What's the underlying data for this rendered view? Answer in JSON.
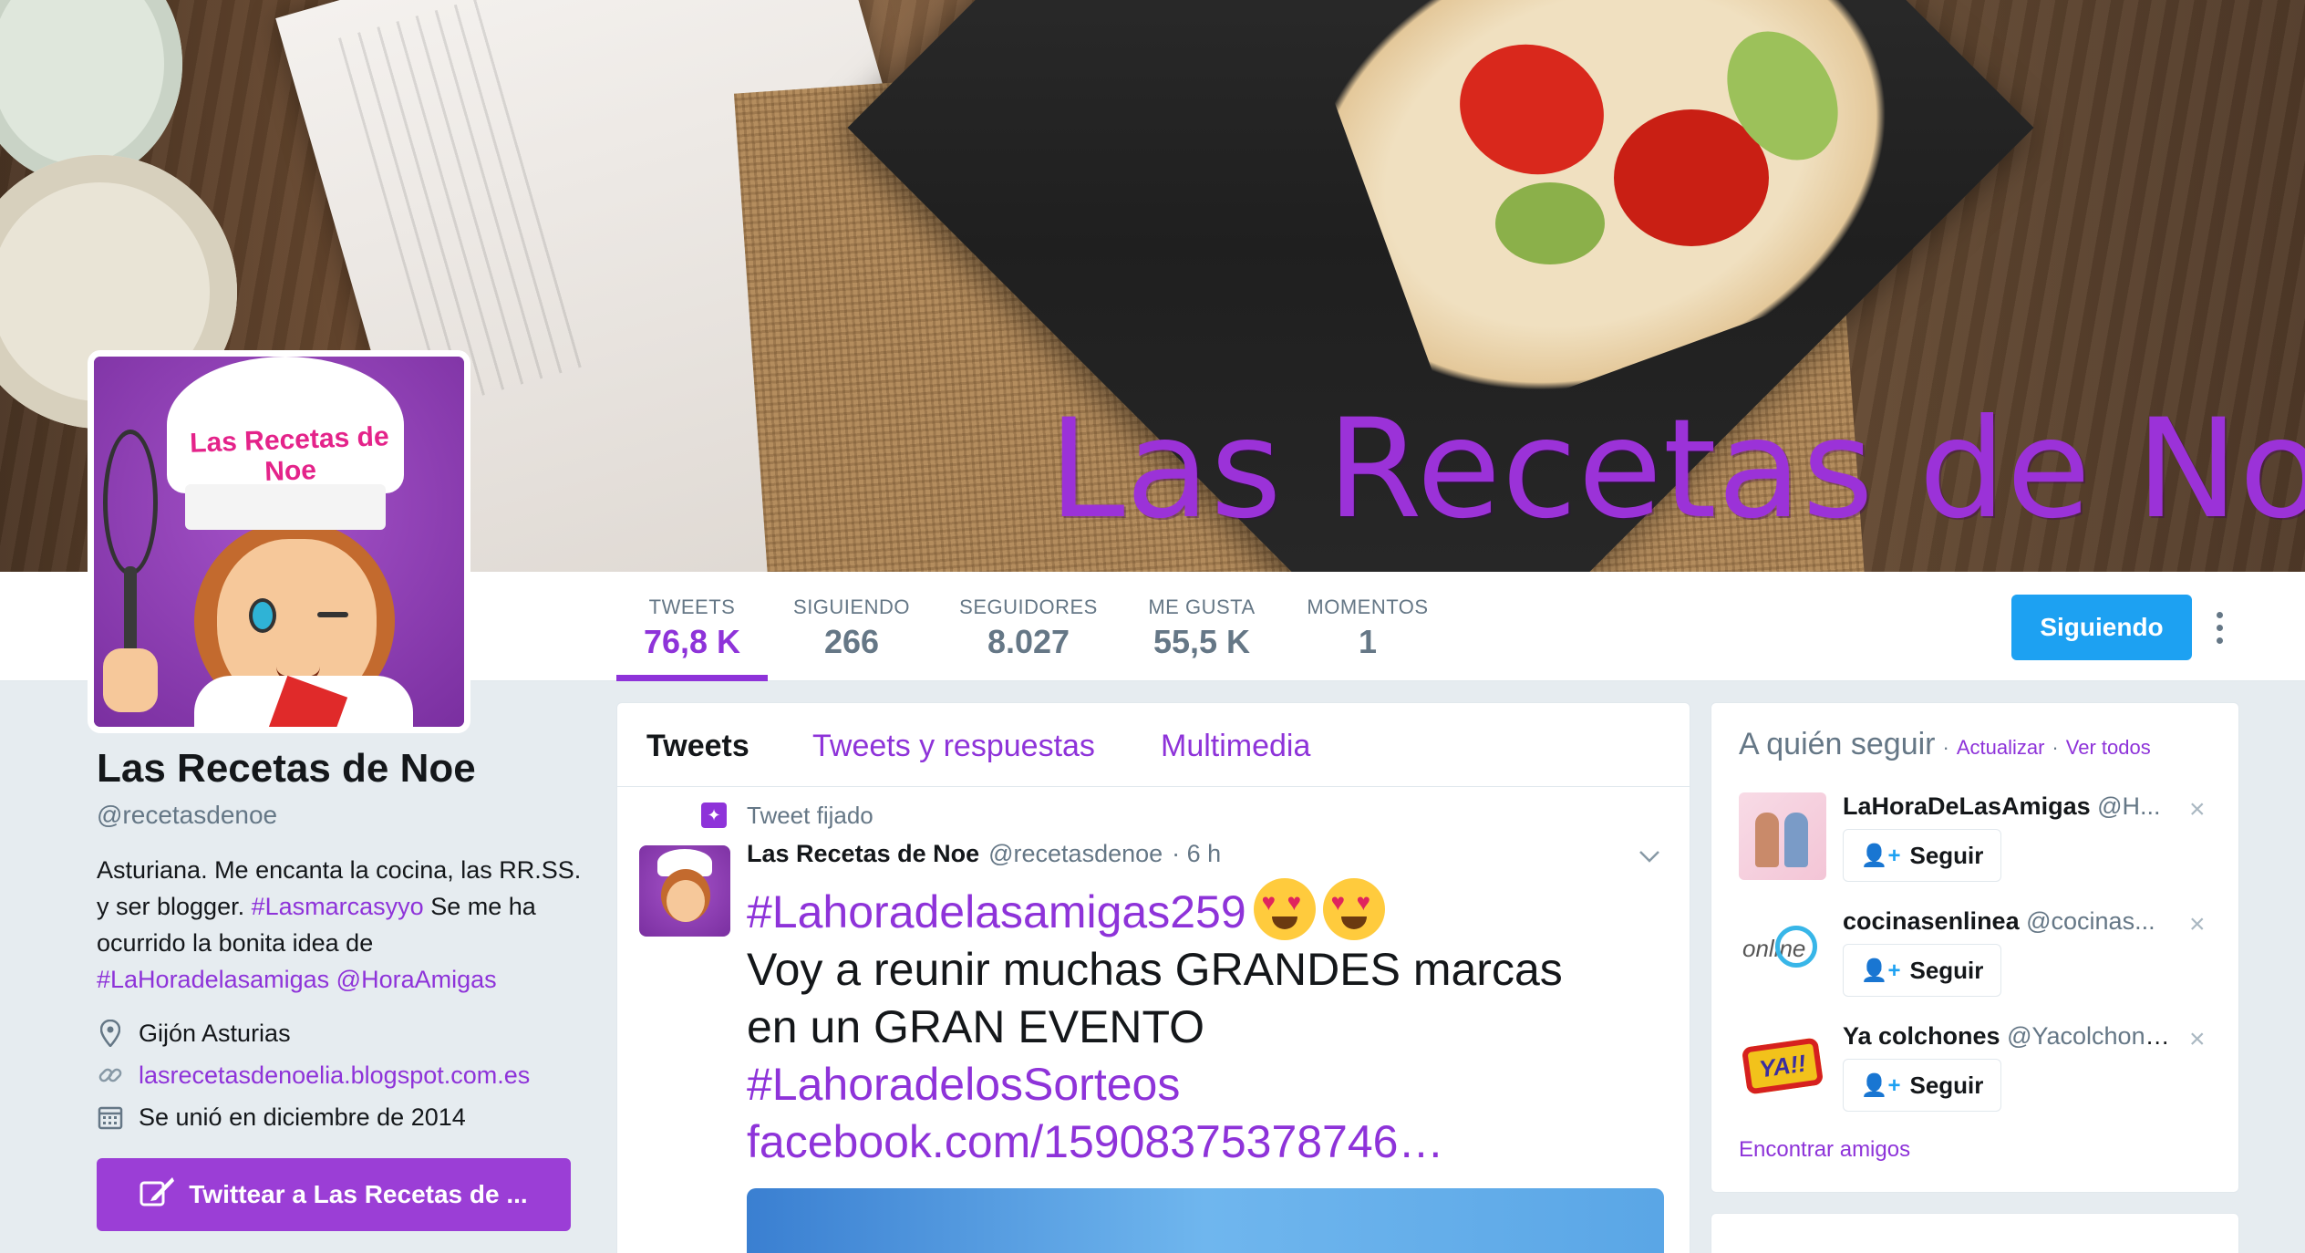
{
  "banner": {
    "title": "Las Recetas de Noe"
  },
  "avatar": {
    "text": "Las Recetas de Noe"
  },
  "nav": {
    "stats": [
      {
        "label": "TWEETS",
        "value": "76,8 K",
        "active": true
      },
      {
        "label": "SIGUIENDO",
        "value": "266"
      },
      {
        "label": "SEGUIDORES",
        "value": "8.027"
      },
      {
        "label": "ME GUSTA",
        "value": "55,5 K"
      },
      {
        "label": "MOMENTOS",
        "value": "1"
      }
    ],
    "follow_button": "Siguiendo"
  },
  "profile": {
    "name": "Las Recetas de Noe",
    "handle": "@recetasdenoe",
    "bio": {
      "part1": "Asturiana. Me encanta la cocina, las RR.SS. y ser blogger. ",
      "tag1": "#Lasmarcasyyo",
      "part2": " Se me ha ocurrido la bonita idea de ",
      "tag2": "#LaHoradelasamigas",
      "part3": " ",
      "tag3": "@HoraAmigas"
    },
    "location": "Gijón Asturias",
    "website": "lasrecetasdenoelia.blogspot.com.es",
    "joined": "Se unió en diciembre de 2014",
    "tweet_to_button": "Twittear a Las Recetas de ..."
  },
  "timeline": {
    "tabs": [
      "Tweets",
      "Tweets y respuestas",
      "Multimedia"
    ],
    "pinned_label": "Tweet fijado",
    "tweet": {
      "author_name": "Las Recetas de Noe",
      "author_handle": "@recetasdenoe",
      "time": "· 6 h",
      "hashtag1": "#Lahoradelasamigas259",
      "line1": "Voy a reunir muchas GRANDES marcas",
      "line2": "en un GRAN EVENTO",
      "hashtag2": "#LahoradelosSorteos",
      "link": "facebook.com/15908375378746…"
    }
  },
  "who_to_follow": {
    "title": "A quién seguir",
    "refresh": "Actualizar",
    "view_all": "Ver todos",
    "separator": "·",
    "follow_label": "Seguir",
    "find_friends": "Encontrar amigos",
    "items": [
      {
        "name": "LaHoraDeLasAmigas",
        "handle": "@H..."
      },
      {
        "name": "cocinasenlinea",
        "handle": "@cocinas..."
      },
      {
        "name": "Ya colchones",
        "handle": "@Yacolchones"
      }
    ],
    "thumb2_text": "online",
    "thumb3_text": "YA!!"
  },
  "colors": {
    "accent": "#8e33d9",
    "follow_blue": "#1da1f2",
    "muted": "#657786"
  }
}
